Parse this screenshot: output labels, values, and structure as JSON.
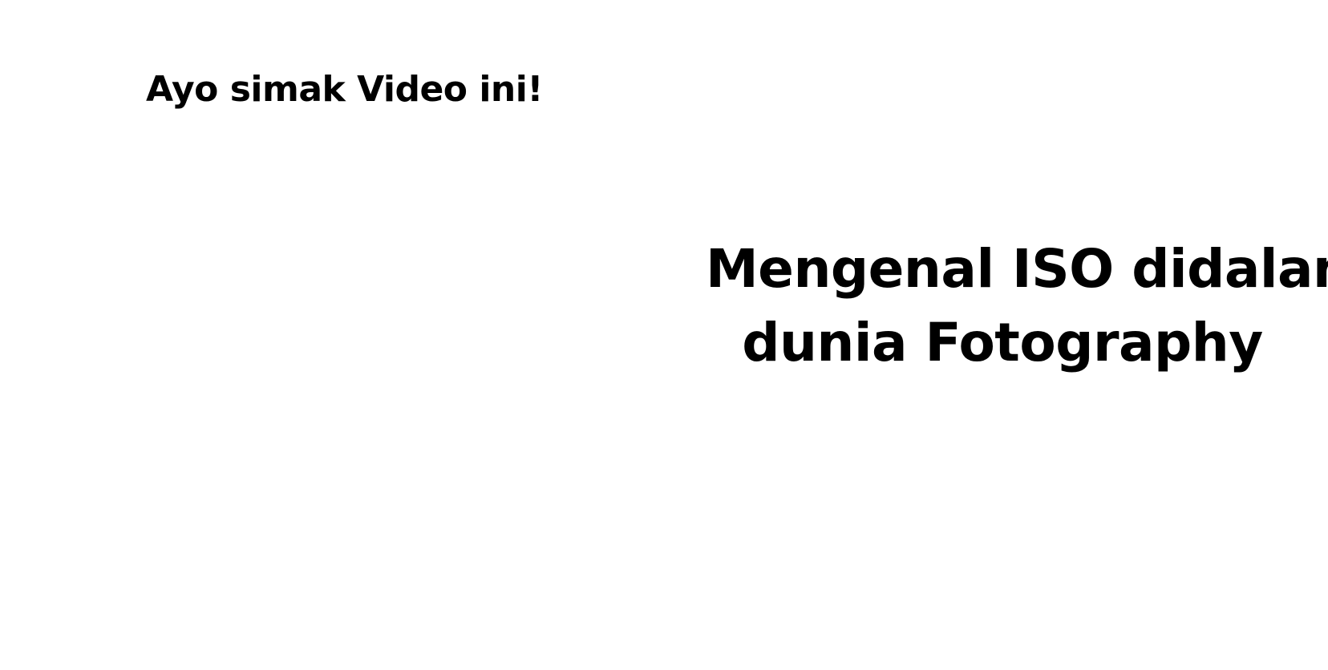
{
  "slide": {
    "intro_text": "Ayo simak Video ini!",
    "title_line_1": "Mengenal ISO didalam",
    "title_line_2": "dunia Fotography"
  },
  "colors": {
    "background": "#ffffff",
    "text": "#000000"
  }
}
